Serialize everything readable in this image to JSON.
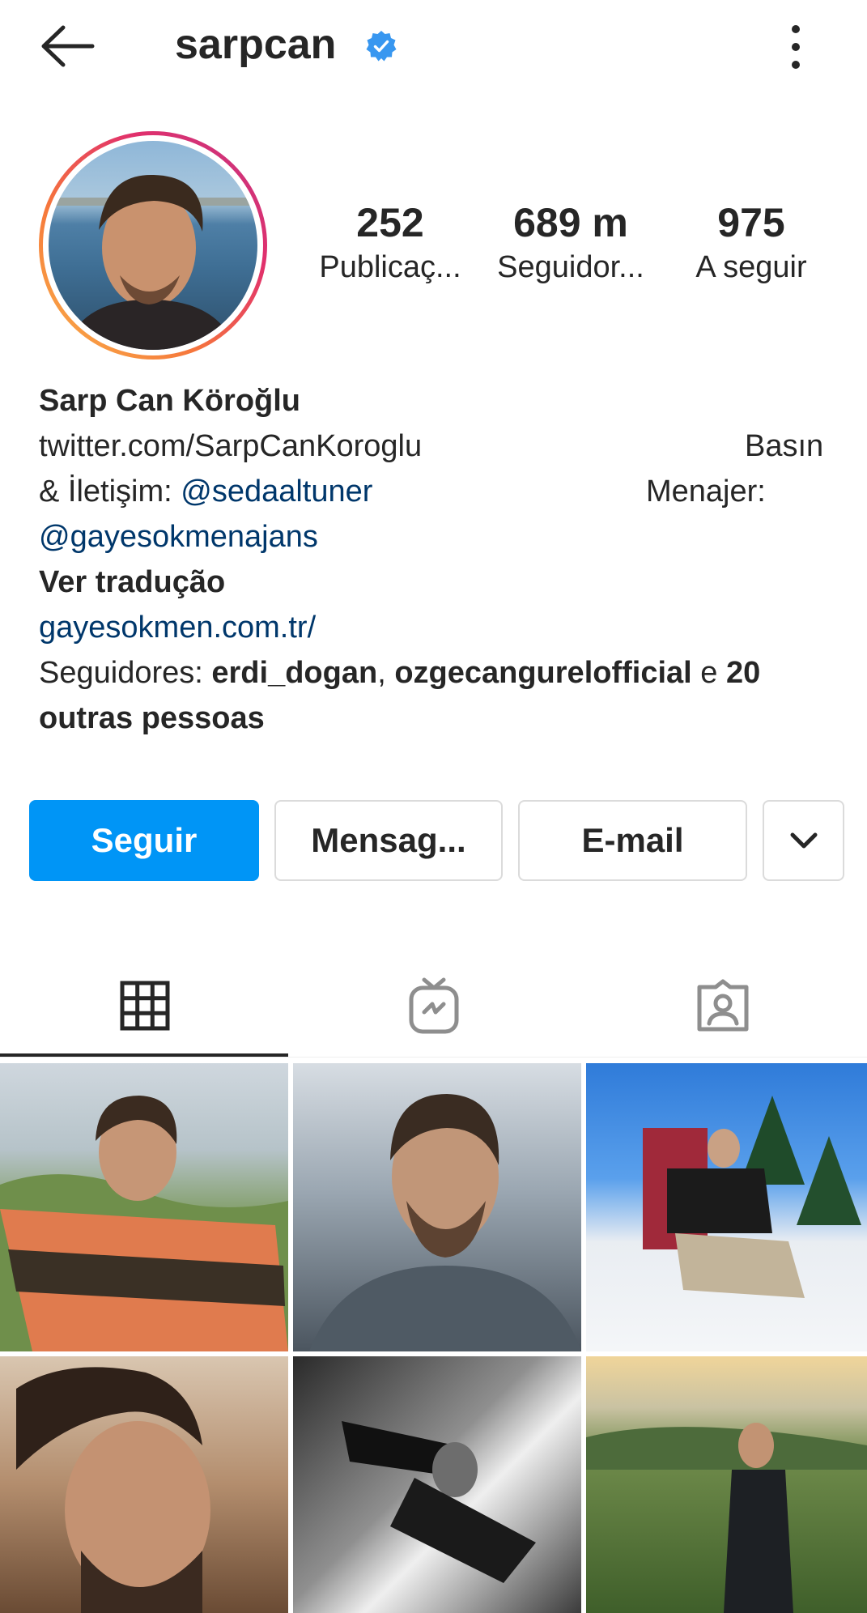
{
  "header": {
    "username": "sarpcan",
    "icons": {
      "back": "arrow-left-icon",
      "verified": "verified-badge-icon",
      "more": "more-vertical-icon"
    }
  },
  "profile": {
    "stats": [
      {
        "value": "252",
        "label": "Publicaç..."
      },
      {
        "value": "689 m",
        "label": "Seguidor..."
      },
      {
        "value": "975",
        "label": "A seguir"
      }
    ],
    "name": "Sarp Can Köroğlu",
    "bio": {
      "line1_left": "twitter.com/SarpCanKoroglu",
      "line1_right": "Basın",
      "line2_prefix": "& İletişim: ",
      "line2_mention": "@sedaaltuner",
      "line2_right": "Menajer:",
      "line3_mention": "@gayesokmenajans"
    },
    "translate": "Ver tradução",
    "website": "gayesokmen.com.tr/",
    "followed_by": {
      "prefix": "Seguidores: ",
      "user1": "erdi_dogan",
      "sep": ", ",
      "user2": "ozgecangurelofficial",
      "conj": " e ",
      "others_a": "20",
      "others_b": "outras pessoas"
    }
  },
  "actions": {
    "follow": "Seguir",
    "message": "Mensag...",
    "email": "E-mail",
    "more_icon": "chevron-down-icon"
  },
  "tabs": [
    {
      "icon": "grid-icon",
      "active": true
    },
    {
      "icon": "igtv-icon",
      "active": false
    },
    {
      "icon": "tagged-icon",
      "active": false
    }
  ],
  "colors": {
    "accent": "#0095f6",
    "link": "#00376b",
    "verified": "#3897f0",
    "text": "#262626",
    "border": "#dbdbdb"
  }
}
